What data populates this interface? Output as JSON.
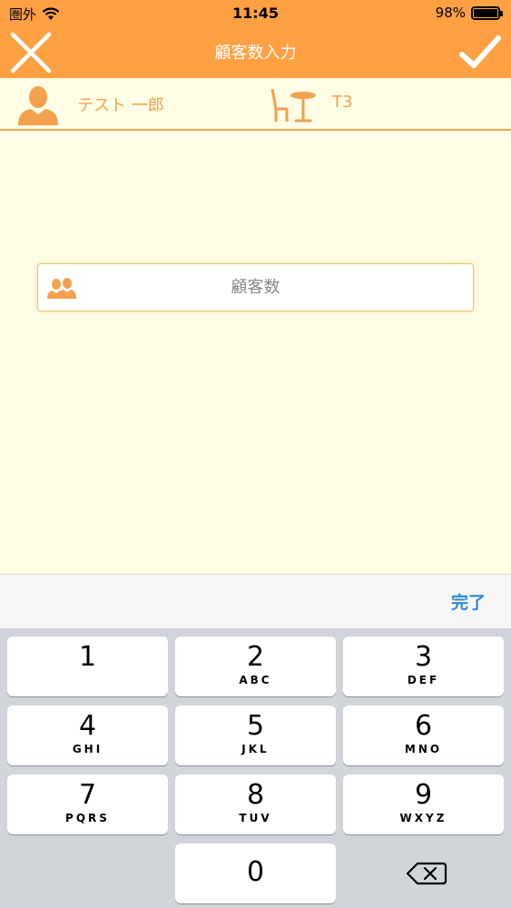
{
  "status_bar": {
    "carrier": "圏外",
    "time": "11:45",
    "battery_text": "98%",
    "battery_level": 0.98
  },
  "nav": {
    "title": "顧客数入力",
    "close_icon": "close-icon",
    "done_icon": "checkmark-icon"
  },
  "info": {
    "user_name": "テスト 一郎",
    "table_name": "T3"
  },
  "input": {
    "placeholder": "顧客数",
    "value": ""
  },
  "accessory": {
    "done_label": "完了"
  },
  "keypad": {
    "keys": [
      {
        "num": "1",
        "letters": ""
      },
      {
        "num": "2",
        "letters": "ABC"
      },
      {
        "num": "3",
        "letters": "DEF"
      },
      {
        "num": "4",
        "letters": "GHI"
      },
      {
        "num": "5",
        "letters": "JKL"
      },
      {
        "num": "6",
        "letters": "MNO"
      },
      {
        "num": "7",
        "letters": "PQRS"
      },
      {
        "num": "8",
        "letters": "TUV"
      },
      {
        "num": "9",
        "letters": "WXYZ"
      },
      {
        "num": "0",
        "letters": ""
      }
    ]
  },
  "colors": {
    "accent": "#ffa043",
    "background": "#fffde6",
    "text_orange": "#f5a04c",
    "link_blue": "#2f88d8"
  }
}
